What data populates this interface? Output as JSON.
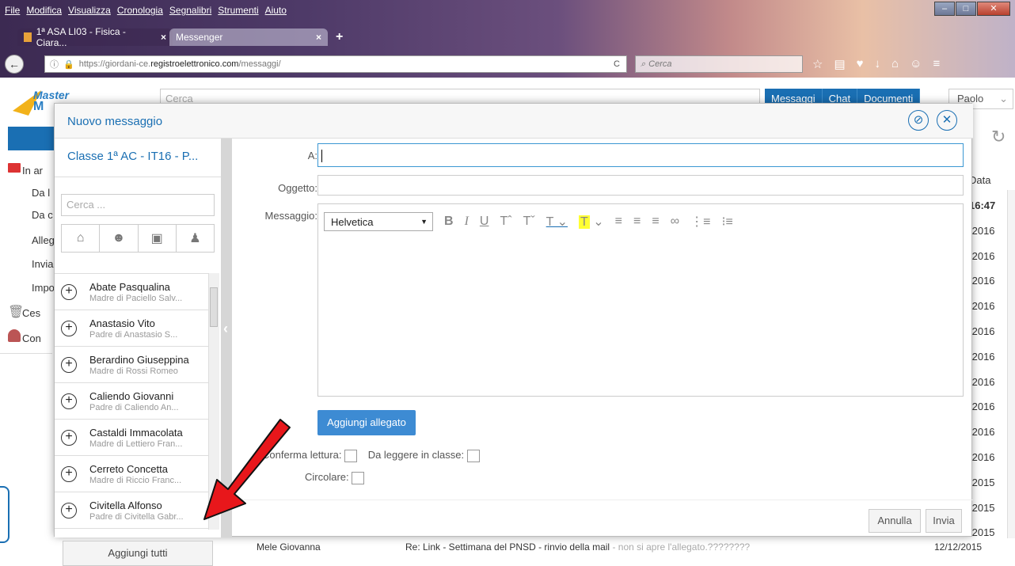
{
  "browser": {
    "menu": [
      "File",
      "Modifica",
      "Visualizza",
      "Cronologia",
      "Segnalibri",
      "Strumenti",
      "Aiuto"
    ],
    "tabs": [
      {
        "label": "1ª ASA LI03 - Fisica - Ciara...",
        "close": "×"
      },
      {
        "label": "Messenger",
        "close": "×"
      }
    ],
    "new_tab": "+",
    "url_prefix": "https://giordani-ce.",
    "url_domain": "registroelettronico.com",
    "url_path": "/messaggi/",
    "search_placeholder": "Cerca",
    "reload": "C"
  },
  "app": {
    "logo_top": "Master",
    "logo_bottom": "M",
    "search_placeholder": "Cerca",
    "top_buttons": [
      "Messaggi",
      "Chat",
      "Documenti"
    ],
    "user": "Paolo",
    "left_nav": [
      "In ar",
      "Da l",
      "Da c",
      "Alleg",
      "Invia",
      "Impo",
      "Ces",
      "Con"
    ],
    "col_header": "Data",
    "dates": [
      "16:47",
      "/2016",
      "/2016",
      "/2016",
      "/2016",
      "/2016",
      "/2016",
      "/2016",
      "/2016",
      "/2016",
      "/2016",
      "/2015",
      "/2015",
      "/2015"
    ],
    "bottom_row": {
      "sender": "Mele Giovanna",
      "subject": "Re: Link - Settimana del PNSD - rinvio della mail",
      "preview": " - non si apre l'allegato.????????",
      "date": "12/12/2015"
    }
  },
  "modal": {
    "title": "Nuovo messaggio",
    "class_name": "Classe 1ª AC - IT16 - P...",
    "search_placeholder": "Cerca ...",
    "contacts": [
      {
        "name": "Abate Pasqualina",
        "relation": "Madre di Paciello Salv..."
      },
      {
        "name": "Anastasio Vito",
        "relation": "Padre di Anastasio S..."
      },
      {
        "name": "Berardino Giuseppina",
        "relation": "Madre di Rossi Romeo"
      },
      {
        "name": "Caliendo Giovanni",
        "relation": "Padre di Caliendo An..."
      },
      {
        "name": "Castaldi Immacolata",
        "relation": "Madre di Lettiero Fran..."
      },
      {
        "name": "Cerreto Concetta",
        "relation": "Madre di Riccio Franc..."
      },
      {
        "name": "Civitella Alfonso",
        "relation": "Padre di Civitella Gabr..."
      }
    ],
    "add_all": "Aggiungi tutti",
    "label_to": "A:",
    "label_subject": "Oggetto:",
    "label_message": "Messaggio:",
    "font": "Helvetica",
    "attach": "Aggiungi allegato",
    "confirm_read": "Conferma lettura:",
    "read_in_class": "Da leggere in classe:",
    "circular": "Circolare:",
    "cancel": "Annulla",
    "send": "Invia"
  },
  "colors": {
    "accent": "#1a6fb3",
    "arrow": "#e8171b"
  }
}
